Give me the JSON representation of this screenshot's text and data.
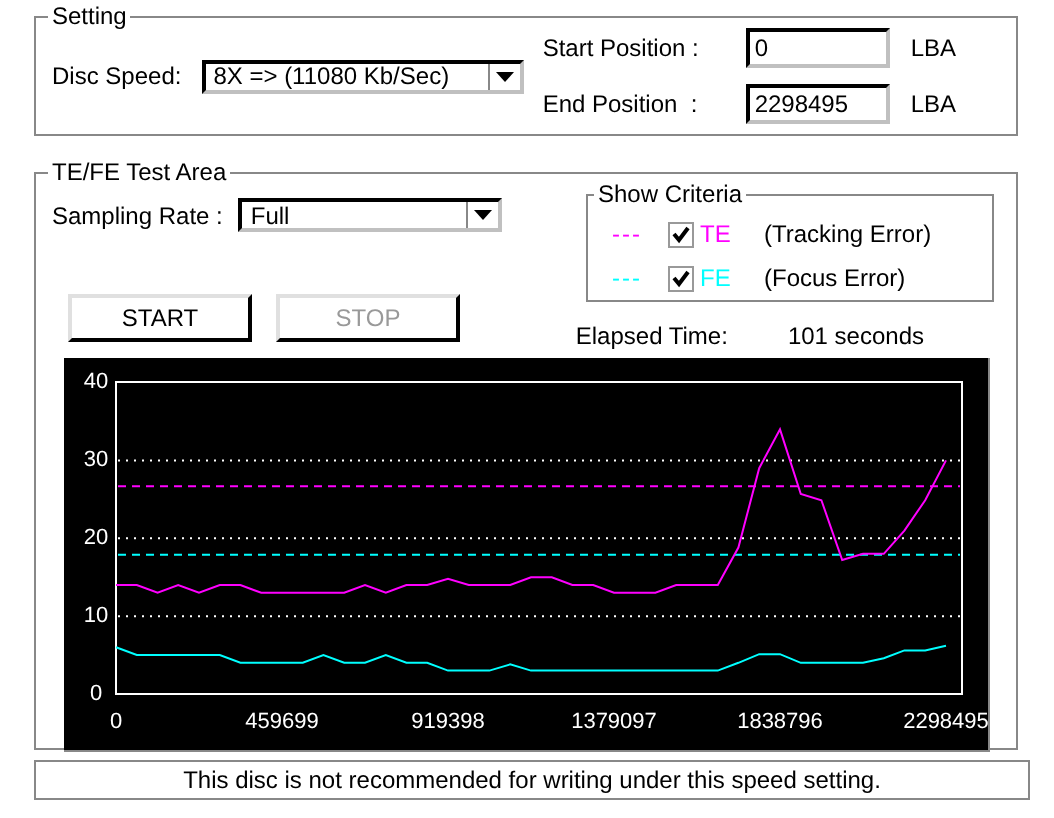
{
  "setting": {
    "title": "Setting",
    "disc_speed": {
      "label": "Disc Speed:",
      "value": "8X => (11080 Kb/Sec)"
    },
    "start_position": {
      "label": "Start Position :",
      "value": "0",
      "unit": "LBA"
    },
    "end_position": {
      "label": "End Position  :",
      "value": "2298495",
      "unit": "LBA"
    }
  },
  "test_area": {
    "title": "TE/FE Test Area",
    "sampling_rate": {
      "label": "Sampling Rate :",
      "value": "Full"
    },
    "criteria": {
      "title": "Show Criteria",
      "items": [
        {
          "line": "---",
          "name": "(Tracking Error)",
          "checked": true
        },
        {
          "line": "---",
          "name": "(Focus Error)",
          "checked": true
        }
      ]
    },
    "buttons": [
      {
        "label": "START",
        "disabled": false
      },
      {
        "label": "STOP",
        "disabled": true
      }
    ],
    "elapsed": {
      "label": "Elapsed Time:",
      "value": "101 seconds"
    },
    "chart_data": {
      "type": "line",
      "grid": true,
      "xlim": [
        0,
        2342806
      ],
      "ylim": [
        0,
        40
      ],
      "xticks": [
        0,
        459699,
        919398,
        1379097,
        1838796,
        2298495
      ],
      "yticks": [
        0,
        10,
        20,
        30,
        40
      ],
      "x": [
        0,
        57462,
        114925,
        172387,
        229850,
        287312,
        344774,
        402237,
        459699,
        517162,
        574624,
        632086,
        689549,
        747011,
        804473,
        861936,
        919398,
        976861,
        1034323,
        1091785,
        1149248,
        1206710,
        1264172,
        1321635,
        1379097,
        1436559,
        1494022,
        1551484,
        1608947,
        1666409,
        1723871,
        1781334,
        1838796,
        1896258,
        1953721,
        2011183,
        2068646,
        2126108,
        2183570,
        2241033,
        2298495
      ],
      "series": [
        {
          "name": "TE",
          "color": "#ff00ff",
          "values": [
            14,
            14,
            13,
            14,
            13,
            14,
            14,
            13,
            13,
            13,
            13,
            13,
            14,
            13,
            14,
            14,
            14.8,
            14,
            14,
            14,
            15,
            15,
            14,
            14,
            13,
            13,
            13,
            14,
            14,
            14,
            18.8,
            29,
            34,
            25.7,
            24.9,
            17.2,
            18,
            18,
            21,
            24.9,
            30
          ]
        },
        {
          "name": "FE",
          "color": "#00ffff",
          "values": [
            6,
            5,
            5,
            5,
            5,
            5,
            4,
            4,
            4,
            4,
            5,
            4,
            4,
            5,
            4,
            4,
            3,
            3,
            3,
            3.8,
            3,
            3,
            3,
            3,
            3,
            3,
            3,
            3,
            3,
            3,
            4,
            5.1,
            5.1,
            4,
            4,
            4,
            4,
            4.6,
            5.6,
            5.6,
            6.2
          ]
        }
      ],
      "ref_lines": [
        {
          "axis": "y",
          "value": 26.7,
          "color": "#ff00ff"
        },
        {
          "axis": "y",
          "value": 17.9,
          "color": "#00ffff"
        }
      ]
    }
  },
  "status_bar": "This disc is not recommended for writing under this speed setting."
}
